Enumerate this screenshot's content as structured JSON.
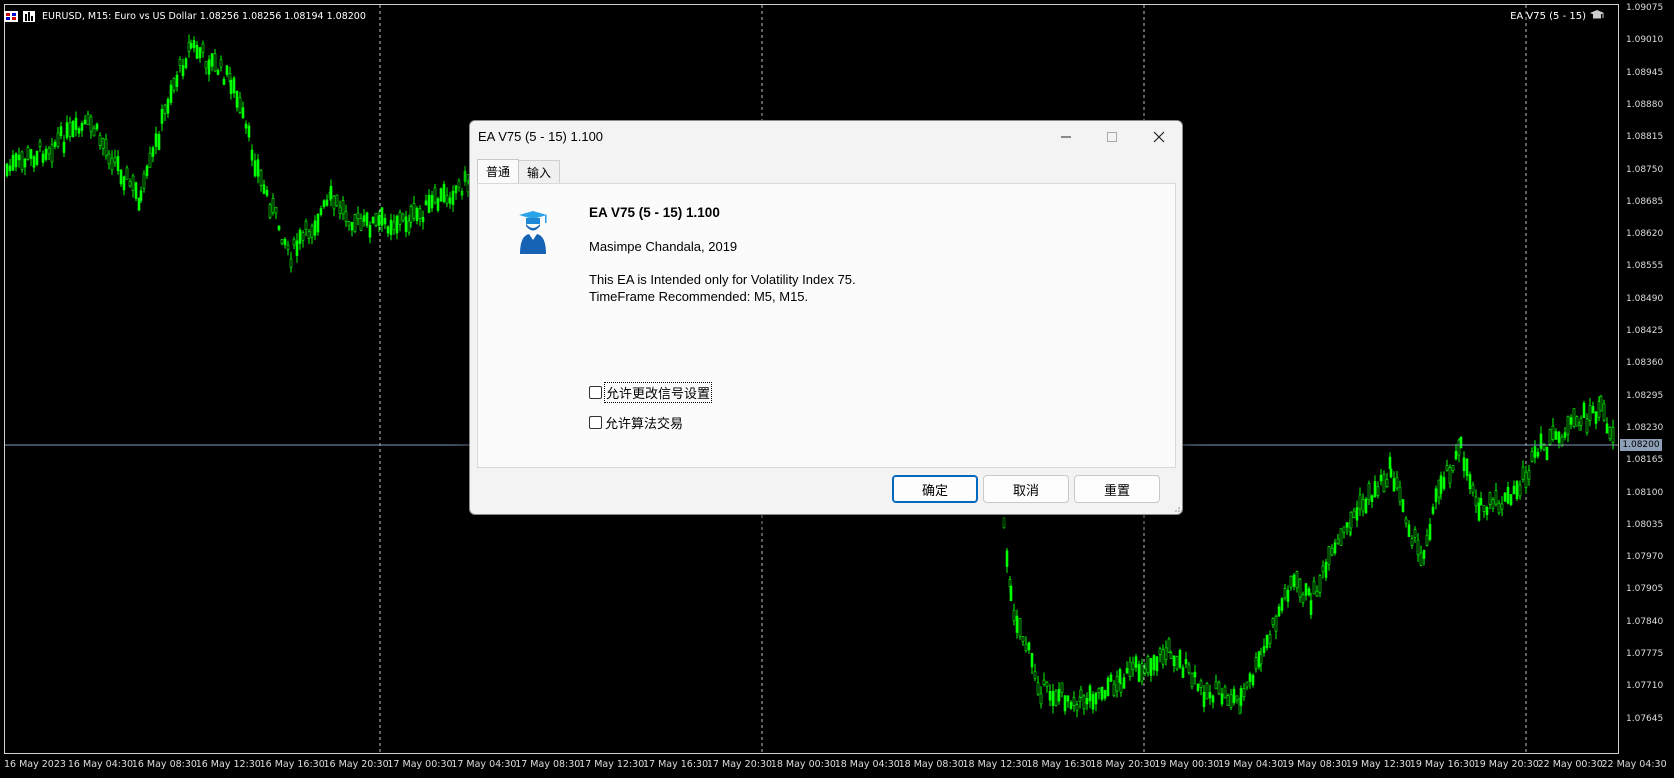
{
  "chart": {
    "symbol_info": "EURUSD, M15:  Euro vs US Dollar  1.08256 1.08256 1.08194 1.08200",
    "ea_label": "EA V75 (5 - 15)",
    "current_price": "1.08200",
    "price_ticks": [
      "1.09075",
      "1.09010",
      "1.08945",
      "1.08880",
      "1.08815",
      "1.08750",
      "1.08685",
      "1.08620",
      "1.08555",
      "1.08490",
      "1.08425",
      "1.08360",
      "1.08295",
      "1.08230",
      "1.08165",
      "1.08100",
      "1.08035",
      "1.07970",
      "1.07905",
      "1.07840",
      "1.07775",
      "1.07710",
      "1.07645"
    ],
    "time_ticks": [
      "16 May 2023",
      "16 May 04:30",
      "16 May 08:30",
      "16 May 12:30",
      "16 May 16:30",
      "16 May 20:30",
      "17 May 00:30",
      "17 May 04:30",
      "17 May 08:30",
      "17 May 12:30",
      "17 May 16:30",
      "17 May 20:30",
      "18 May 00:30",
      "18 May 04:30",
      "18 May 08:30",
      "18 May 12:30",
      "18 May 16:30",
      "18 May 20:30",
      "19 May 00:30",
      "19 May 04:30",
      "19 May 08:30",
      "19 May 12:30",
      "19 May 16:30",
      "19 May 20:30",
      "22 May 00:30",
      "22 May 04:30"
    ],
    "colors": {
      "candle": "#00ff00",
      "background": "#000000",
      "grid": "#c0c0c0",
      "price_line": "#7f9db9"
    }
  },
  "dialog": {
    "title": "EA V75 (5 - 15) 1.100",
    "tabs": [
      {
        "label": "普通"
      },
      {
        "label": "输入"
      }
    ],
    "ea_name": "EA V75 (5 - 15) 1.100",
    "author": "Masimpe Chandala, 2019",
    "description_line1": "This EA is Intended only for Volatility Index 75.",
    "description_line2": "TimeFrame Recommended: M5, M15.",
    "checkbox_signal": {
      "label": "允许更改信号设置",
      "checked": false
    },
    "checkbox_algo": {
      "label": "允许算法交易",
      "checked": false
    },
    "buttons": {
      "ok": "确定",
      "cancel": "取消",
      "reset": "重置"
    },
    "icons": {
      "minimize": "minimize-icon",
      "maximize": "maximize-icon",
      "close": "close-icon",
      "expert": "graduate-icon"
    }
  }
}
